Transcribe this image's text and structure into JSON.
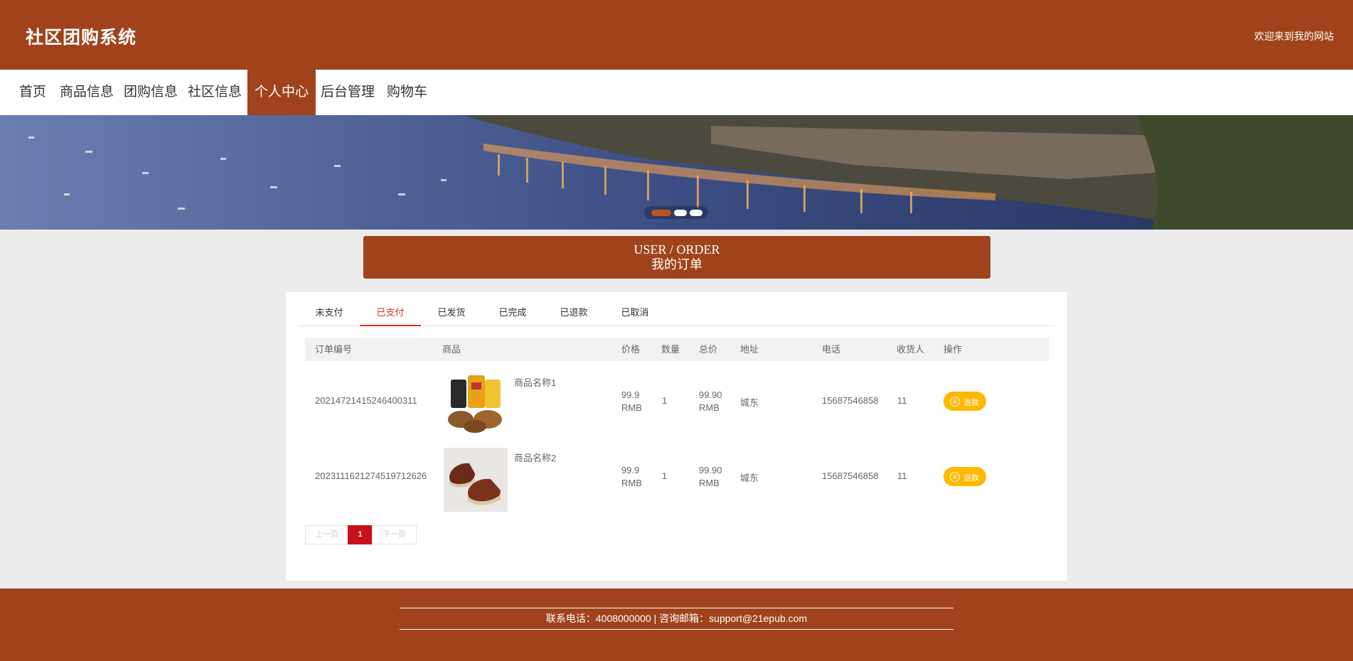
{
  "header": {
    "title": "社区团购系统",
    "welcome": "欢迎来到我的网站"
  },
  "nav": [
    "首页",
    "商品信息",
    "团购信息",
    "社区信息",
    "个人中心",
    "后台管理",
    "购物车"
  ],
  "nav_active": "个人中心",
  "section": {
    "title_en": "USER / ORDER",
    "title_cn": "我的订单"
  },
  "tabs": [
    "未支付",
    "已支付",
    "已发货",
    "已完成",
    "已退款",
    "已取消"
  ],
  "active_tab": "已支付",
  "table": {
    "headers": [
      "订单编号",
      "商品",
      "价格",
      "数量",
      "总价",
      "地址",
      "电话",
      "收货人",
      "操作"
    ],
    "rows": [
      {
        "order_no": "20214721415246400311",
        "product": "商品名称1",
        "price": "99.9",
        "currency": "RMB",
        "qty": "1",
        "total": "99.90",
        "address": "城东",
        "phone": "15687546858",
        "receiver": "11",
        "action": "退款"
      },
      {
        "order_no": "2023111621274519712626",
        "product": "商品名称2",
        "price": "99.9",
        "currency": "RMB",
        "qty": "1",
        "total": "99.90",
        "address": "城东",
        "phone": "15687546858",
        "receiver": "11",
        "action": "退款"
      }
    ]
  },
  "pager": {
    "prev": "上一页",
    "current": "1",
    "next": "下一页"
  },
  "footer": {
    "contact": "联系电话：4008000000 | 咨询邮箱：support@21epub.com"
  },
  "icons": {
    "refund": "yuan-icon"
  },
  "colors": {
    "brand": "#a0431c",
    "active_tab": "#d6322c",
    "refund_button": "#ffb800",
    "current_page": "#c8111a"
  }
}
